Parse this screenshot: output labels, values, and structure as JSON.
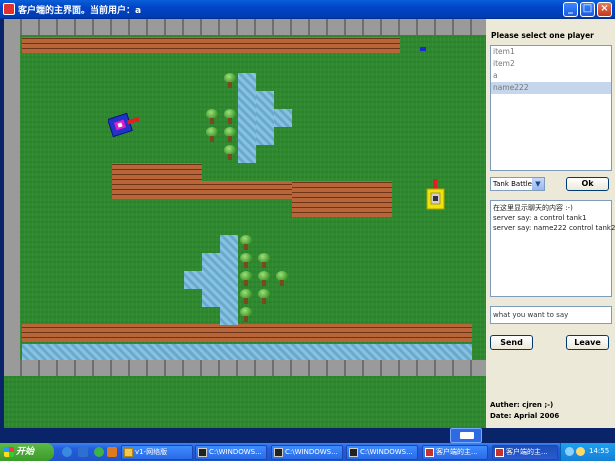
{
  "window": {
    "title": "客户端的主界面。当前用户：a"
  },
  "panel": {
    "select_label": "Please select one player",
    "players": [
      "item1",
      "item2",
      "a",
      "name222"
    ],
    "selected_player": "name222",
    "game_select": "Tank Battle",
    "ok_label": "Ok",
    "chat_lines": [
      "在这里显示聊天的内容 :-)",
      "server say: a control tank1",
      "server say: name222 control tank2"
    ],
    "message_input": "what you want to say",
    "send_label": "Send",
    "leave_label": "Leave",
    "author": "Auther: cjren ;-)",
    "date": "Date: Aprial 2006"
  },
  "game": {
    "tank1_color": "#2233cc",
    "tank2_color": "#f2e20a",
    "grass_color": "#2e8a2e"
  },
  "taskbar": {
    "start_label": "开始",
    "tasks": [
      {
        "label": "v1-网络版",
        "icon": "folder-icon"
      },
      {
        "label": "C:\\WINDOWS...",
        "icon": "console-icon"
      },
      {
        "label": "C:\\WINDOWS...",
        "icon": "console-icon"
      },
      {
        "label": "C:\\WINDOWS...",
        "icon": "console-icon"
      },
      {
        "label": "客户端的主...",
        "icon": "java-app-icon"
      },
      {
        "label": "客户端的主...",
        "icon": "java-app-icon"
      }
    ],
    "clock": "14:55"
  }
}
